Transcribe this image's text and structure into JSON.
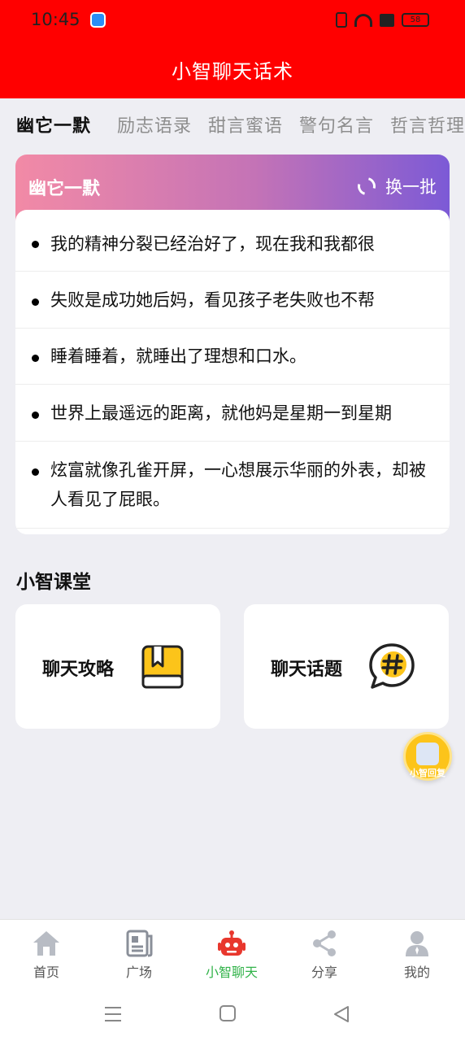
{
  "status_bar": {
    "time": "10:45",
    "battery": "58"
  },
  "header": {
    "title": "小智聊天话术"
  },
  "tabs": [
    {
      "label": "幽它一默",
      "active": true
    },
    {
      "label": "励志语录",
      "active": false
    },
    {
      "label": "甜言蜜语",
      "active": false
    },
    {
      "label": "警句名言",
      "active": false
    },
    {
      "label": "哲言哲理",
      "active": false
    }
  ],
  "quote_card": {
    "title": "幽它一默",
    "refresh_label": "换一批",
    "gradient_colors": [
      "#f28aa6",
      "#c473b6",
      "#7c5ad6"
    ],
    "quotes": [
      "我的精神分裂已经治好了，现在我和我都很",
      "失败是成功她后妈，看见孩子老失败也不帮",
      "睡着睡着，就睡出了理想和口水。",
      "世界上最遥远的距离，就他妈是星期一到星期",
      "炫富就像孔雀开屏，一心想展示华丽的外表，却被人看见了屁眼。"
    ]
  },
  "classroom": {
    "title": "小智课堂",
    "items": [
      {
        "label": "聊天攻略",
        "icon": "book-icon"
      },
      {
        "label": "聊天话题",
        "icon": "hashtag-chat-icon"
      }
    ]
  },
  "floating_button": {
    "label": "小智回复"
  },
  "bottom_nav": [
    {
      "label": "首页",
      "icon": "home-icon",
      "active": false
    },
    {
      "label": "广场",
      "icon": "news-icon",
      "active": false
    },
    {
      "label": "小智聊天",
      "icon": "robot-icon",
      "active": true
    },
    {
      "label": "分享",
      "icon": "share-icon",
      "active": false
    },
    {
      "label": "我的",
      "icon": "user-icon",
      "active": false
    }
  ],
  "colors": {
    "header": "#ff0000",
    "active_nav": "#32b34a",
    "icon_yellow": "#fcc41a"
  }
}
